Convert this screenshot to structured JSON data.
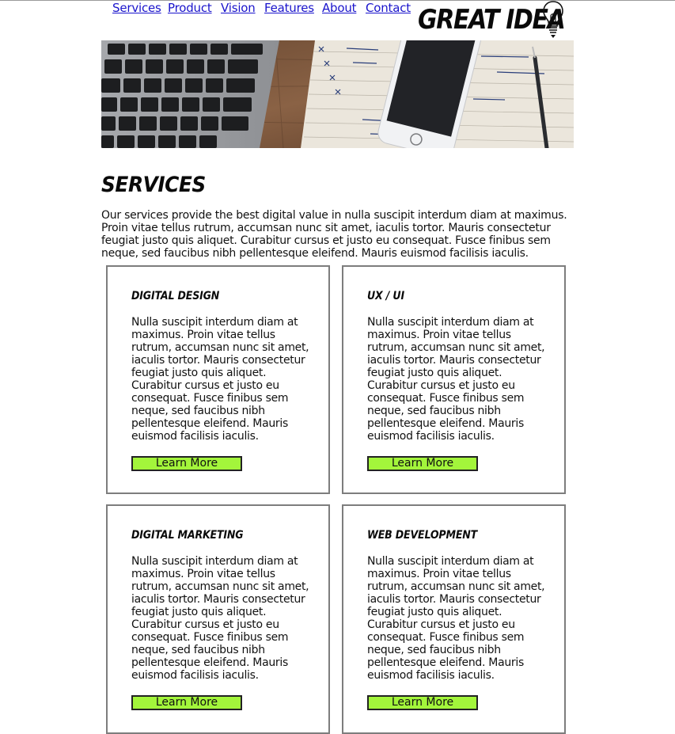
{
  "nav": {
    "items": [
      "Services",
      "Product",
      "Vision",
      "Features",
      "About",
      "Contact"
    ]
  },
  "logo": {
    "text": "GREAT IDEA",
    "icon": "lightbulb-icon"
  },
  "hero": {
    "alt": "Laptop keyboard, smartphone and notebook on a wooden desk"
  },
  "services": {
    "title": "SERVICES",
    "intro": "Our services provide the best digital value in nulla suscipit interdum diam at maximus. Proin vitae tellus rutrum, accumsan nunc sit amet, iaculis tortor. Mauris consectetur feugiat justo quis aliquet. Curabitur cursus et justo eu consequat. Fusce finibus sem neque, sed faucibus nibh pellentesque eleifend. Mauris euismod facilisis iaculis.",
    "cards": [
      {
        "title": "DIGITAL DESIGN",
        "text": "Nulla suscipit interdum diam at maximus. Proin vitae tellus rutrum, accumsan nunc sit amet, iaculis tortor. Mauris consectetur feugiat justo quis aliquet. Curabitur cursus et justo eu consequat. Fusce finibus sem neque, sed faucibus nibh pellentesque eleifend. Mauris euismod facilisis iaculis.",
        "button": "Learn More"
      },
      {
        "title": "UX / UI",
        "text": "Nulla suscipit interdum diam at maximus. Proin vitae tellus rutrum, accumsan nunc sit amet, iaculis tortor. Mauris consectetur feugiat justo quis aliquet. Curabitur cursus et justo eu consequat. Fusce finibus sem neque, sed faucibus nibh pellentesque eleifend. Mauris euismod facilisis iaculis.",
        "button": "Learn More"
      },
      {
        "title": "DIGITAL MARKETING",
        "text": "Nulla suscipit interdum diam at maximus. Proin vitae tellus rutrum, accumsan nunc sit amet, iaculis tortor. Mauris consectetur feugiat justo quis aliquet. Curabitur cursus et justo eu consequat. Fusce finibus sem neque, sed faucibus nibh pellentesque eleifend. Mauris euismod facilisis iaculis.",
        "button": "Learn More"
      },
      {
        "title": "WEB DEVELOPMENT",
        "text": "Nulla suscipit interdum diam at maximus. Proin vitae tellus rutrum, accumsan nunc sit amet, iaculis tortor. Mauris consectetur feugiat justo quis aliquet. Curabitur cursus et justo eu consequat. Fusce finibus sem neque, sed faucibus nibh pellentesque eleifend. Mauris euismod facilisis iaculis.",
        "button": "Learn More"
      }
    ]
  },
  "colors": {
    "link": "#1a14cc",
    "button_bg": "#a3f53b",
    "card_border": "#7d7d7d",
    "text": "#111111"
  }
}
